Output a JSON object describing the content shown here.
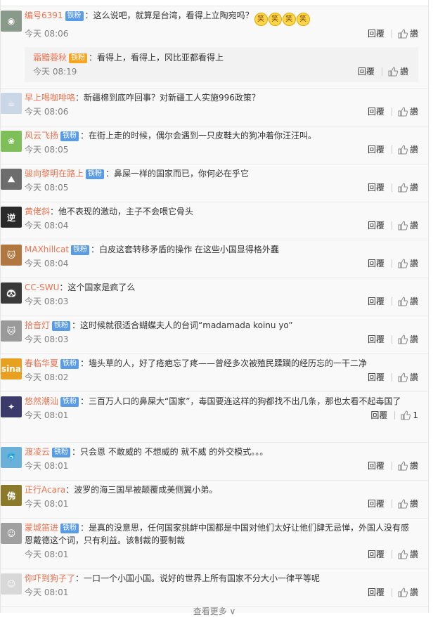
{
  "comments": [
    {
      "nick": "编号6391",
      "badge": "铁粉",
      "text": "这么说吧，就算是台湾，看得上立陶宛吗？",
      "emoji": [
        "笑",
        "笑",
        "笑",
        "笑"
      ],
      "time": "今天 08:06",
      "reply": "回覆",
      "like": "讚",
      "avatar_color": "#8a9a8a",
      "avatar_glyph": "◉"
    },
    {
      "nick": "早上喝咖啡咯",
      "badge": "",
      "text": "新疆棉到底咋回事？对新疆工人实施996政策？",
      "time": "今天 08:06",
      "reply": "回覆",
      "like": "讚",
      "avatar_color": "#c9d7e6",
      "avatar_glyph": "☕"
    },
    {
      "nick": "风云飞扬",
      "badge": "铁粉",
      "text": "在街上走的时候，偶尔会遇到一只皮鞋大的狗冲着你汪汪叫。",
      "time": "今天 08:05",
      "reply": "回覆",
      "like": "讚",
      "avatar_color": "#7fbf5a",
      "avatar_glyph": "❀"
    },
    {
      "nick": "骏向黎明在路上",
      "badge": "铁粉",
      "text": "鼻屎一样的国家而已，你何必在乎它",
      "time": "今天 08:05",
      "reply": "回覆",
      "like": "讚",
      "avatar_color": "#6d6d6d",
      "avatar_glyph": "⛰"
    },
    {
      "nick": "黄佬斜",
      "badge": "",
      "text": "他不表现的激动，主子不会喂它骨头",
      "time": "今天 08:04",
      "reply": "回覆",
      "like": "讚",
      "avatar_color": "#2a2a2a",
      "avatar_glyph": "逆"
    },
    {
      "nick": "MAXhillcat",
      "badge": "铁粉",
      "text": "白皮这套转移矛盾的操作 在这些小国显得格外蠢",
      "time": "今天 08:04",
      "reply": "回覆",
      "like": "讚",
      "avatar_color": "#b07840",
      "avatar_glyph": "🐱"
    },
    {
      "nick": "CC-SWU",
      "badge": "",
      "text": "这个国家是疯了么",
      "time": "今天 08:03",
      "reply": "回覆",
      "like": "讚",
      "avatar_color": "#3a3a3a",
      "avatar_glyph": "🐼"
    },
    {
      "nick": "拾音灯",
      "badge": "铁粉",
      "text": "这时候就很适合蝴蝶夫人的台词“madamada koinu yo”",
      "time": "今天 08:03",
      "reply": "回覆",
      "like": "讚",
      "avatar_color": "#9a9a9a",
      "avatar_glyph": "🐱"
    },
    {
      "nick": "春临华夏",
      "badge": "铁粉",
      "text": "墙头草的人，好了疮疤忘了疼——曾经多次被殖民蹂躏的经历忘的一干二净",
      "time": "今天 08:02",
      "reply": "回覆",
      "like": "讚",
      "avatar_color": "#e8a020",
      "avatar_glyph": "sina"
    },
    {
      "nick": "悠然潮汕",
      "badge": "铁粉",
      "text": "三百万人口的鼻屎大“国家”，毒国要连这样的狗都找不出几条，那也太看不起毒国了",
      "time": "今天 08:01",
      "reply": "回覆",
      "like": "1",
      "avatar_color": "#3b3b6b",
      "avatar_glyph": "✦"
    },
    {
      "nick": "渡凌云",
      "badge": "铁粉",
      "text": "只会恩 不敢威的 不想威的 就不威 的外交模式。。。",
      "time": "今天 08:01",
      "reply": "回覆",
      "like": "讚",
      "avatar_color": "#6ab0d8",
      "avatar_glyph": "🐬"
    },
    {
      "nick": "正行Acara",
      "badge": "",
      "text": "波罗的海三国早被颠覆成美侧翼小弟。",
      "time": "今天 08:01",
      "reply": "回覆",
      "like": "讚",
      "avatar_color": "#8a7a2a",
      "avatar_glyph": "佛"
    },
    {
      "nick": "蒙城笛进",
      "badge": "铁粉",
      "text": "是真的没意思，任何国家挑衅中国都是中国对他们太好让他们肆无忌惮，外国人没有感恩戴德这个词，只有利益。该制裁的要制裁",
      "time": "今天 08:01",
      "reply": "回覆",
      "like": "讚",
      "avatar_color": "#a0a0a0",
      "avatar_glyph": "☺"
    },
    {
      "nick": "你吓到狗子了",
      "badge": "",
      "text": "一口一个小国小国。说好的世界上所有国家不分大小一律平等呢",
      "time": "今天 08:01",
      "reply": "回覆",
      "like": "讚",
      "avatar_color": "#d8d8d8",
      "avatar_glyph": "☺"
    }
  ],
  "subreply": {
    "nick": "霜黯蓉秋",
    "badge": "铁粉",
    "text": "看得上，看得上，冈比亚都看得上",
    "time": "今天 08:19",
    "reply": "回覆",
    "like": "讚"
  },
  "more_label": "查看更多 ∨"
}
